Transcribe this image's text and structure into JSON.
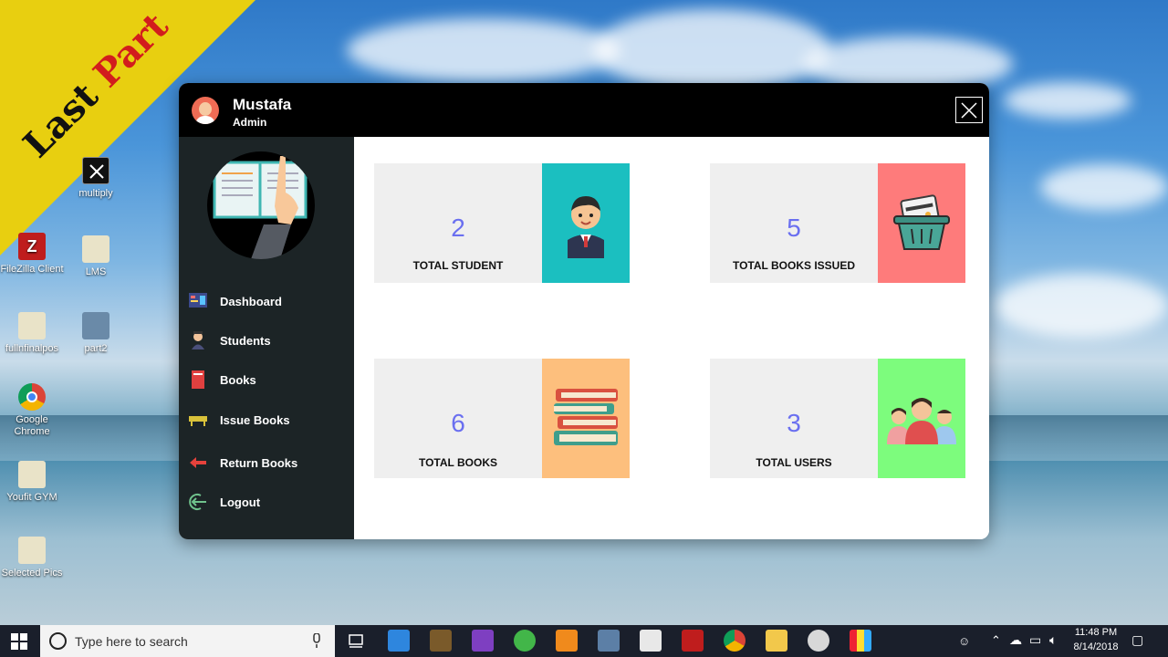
{
  "banner": {
    "word1": "Last",
    "word2": "Part"
  },
  "desktop_icons": [
    {
      "label": "multiply"
    },
    {
      "label": "FileZilla Client"
    },
    {
      "label": "LMS"
    },
    {
      "label": "fullnfinalpos"
    },
    {
      "label": "part2"
    },
    {
      "label": "Google Chrome"
    },
    {
      "label": "Youfit GYM"
    },
    {
      "label": "Selected Pics"
    }
  ],
  "header": {
    "name": "Mustafa",
    "role": "Admin"
  },
  "sidebar": {
    "items": [
      {
        "label": "Dashboard",
        "icon": "dashboard-icon"
      },
      {
        "label": "Students",
        "icon": "student-icon"
      },
      {
        "label": "Books",
        "icon": "book-icon"
      },
      {
        "label": "Issue Books",
        "icon": "issue-icon"
      },
      {
        "label": "Return Books",
        "icon": "return-arrow-icon"
      },
      {
        "label": "Logout",
        "icon": "logout-icon"
      }
    ]
  },
  "cards": [
    {
      "value": "2",
      "caption": "TOTAL STUDENT",
      "color": "#1bbfc0",
      "icon": "student-avatar-icon"
    },
    {
      "value": "5",
      "caption": "TOTAL BOOKS ISSUED",
      "color": "#fe7b7b",
      "icon": "basket-card-icon"
    },
    {
      "value": "6",
      "caption": "TOTAL BOOKS",
      "color": "#fdbf7d",
      "icon": "book-stack-icon"
    },
    {
      "value": "3",
      "caption": "TOTAL USERS",
      "color": "#7dfc7d",
      "icon": "users-group-icon"
    }
  ],
  "taskbar": {
    "search_placeholder": "Type here to search",
    "time": "11:48 PM",
    "date": "8/14/2018"
  },
  "colors": {
    "titlebar": "#000000",
    "sidebar": "#1c2426",
    "accent_number": "#6a6ff0"
  }
}
